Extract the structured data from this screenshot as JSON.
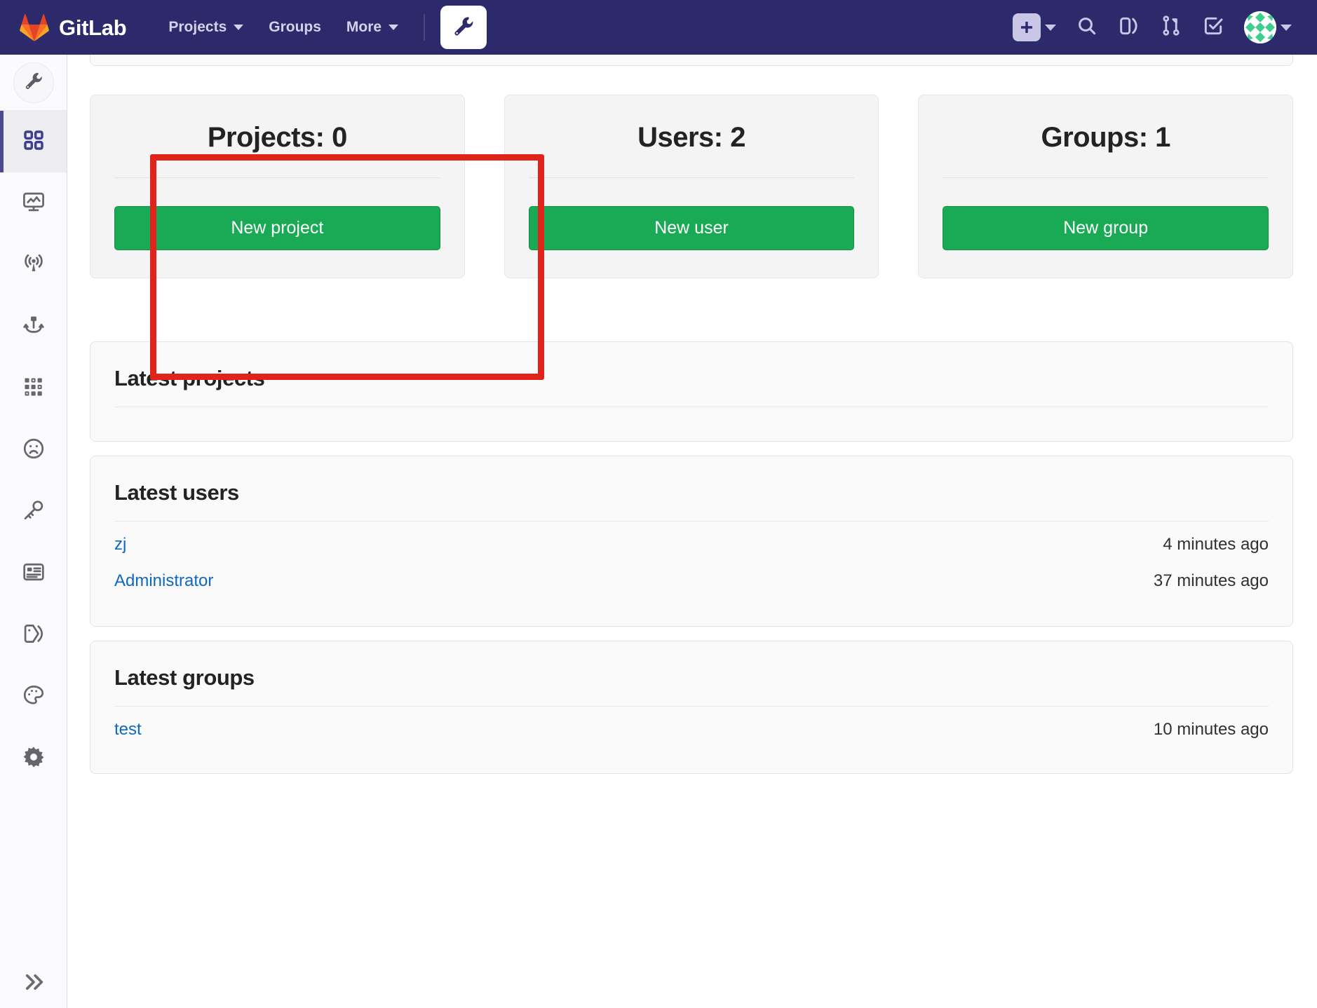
{
  "navbar": {
    "brand_name": "GitLab",
    "logo_icon": "gitlab-tanuki-logo",
    "links": [
      {
        "label": "Projects",
        "has_caret": true,
        "icon": "chevron-down-icon"
      },
      {
        "label": "Groups",
        "has_caret": false,
        "icon": ""
      },
      {
        "label": "More",
        "has_caret": true,
        "icon": "chevron-down-icon"
      }
    ],
    "admin_button_icon": "wrench-icon",
    "right_icons": [
      {
        "name": "plus-icon",
        "has_caret": true
      },
      {
        "name": "search-icon",
        "has_caret": false
      },
      {
        "name": "issues-icon",
        "has_caret": false
      },
      {
        "name": "merge-requests-icon",
        "has_caret": false
      },
      {
        "name": "todos-icon",
        "has_caret": false
      },
      {
        "name": "user-avatar",
        "has_caret": true
      }
    ]
  },
  "sidebar": {
    "avatar_icon": "wrench-icon",
    "collapse_icon": "double-chevron-right-icon",
    "items": [
      {
        "icon": "dashboard-grid-icon",
        "name": "overview",
        "active": true
      },
      {
        "icon": "monitoring-icon",
        "name": "monitoring",
        "active": false
      },
      {
        "icon": "broadcast-icon",
        "name": "messages",
        "active": false
      },
      {
        "icon": "hook-icon",
        "name": "system-hooks",
        "active": false
      },
      {
        "icon": "applications-icon",
        "name": "applications",
        "active": false
      },
      {
        "icon": "abuse-report-icon",
        "name": "abuse-reports",
        "active": false
      },
      {
        "icon": "key-icon",
        "name": "deploy-keys",
        "active": false
      },
      {
        "icon": "license-icon",
        "name": "license",
        "active": false
      },
      {
        "icon": "labels-icon",
        "name": "labels",
        "active": false
      },
      {
        "icon": "palette-icon",
        "name": "appearance",
        "active": false
      },
      {
        "icon": "gear-icon",
        "name": "settings",
        "active": false
      }
    ]
  },
  "stats": [
    {
      "title": "Projects: 0",
      "button": "New project",
      "highlighted": true
    },
    {
      "title": "Users: 2",
      "button": "New user",
      "highlighted": false
    },
    {
      "title": "Groups: 1",
      "button": "New group",
      "highlighted": false
    }
  ],
  "panels": {
    "projects": {
      "heading": "Latest projects",
      "rows": []
    },
    "users": {
      "heading": "Latest users",
      "rows": [
        {
          "label": "zj",
          "time": "4 minutes ago"
        },
        {
          "label": "Administrator",
          "time": "37 minutes ago"
        }
      ]
    },
    "groups": {
      "heading": "Latest groups",
      "rows": [
        {
          "label": "test",
          "time": "10 minutes ago"
        }
      ]
    }
  },
  "colors": {
    "navbar_bg": "#2c2a6b",
    "primary_green": "#1aaa55",
    "link_blue": "#1068bf",
    "highlight_red": "#e0241b",
    "sidebar_active": "#4c4a8c"
  }
}
